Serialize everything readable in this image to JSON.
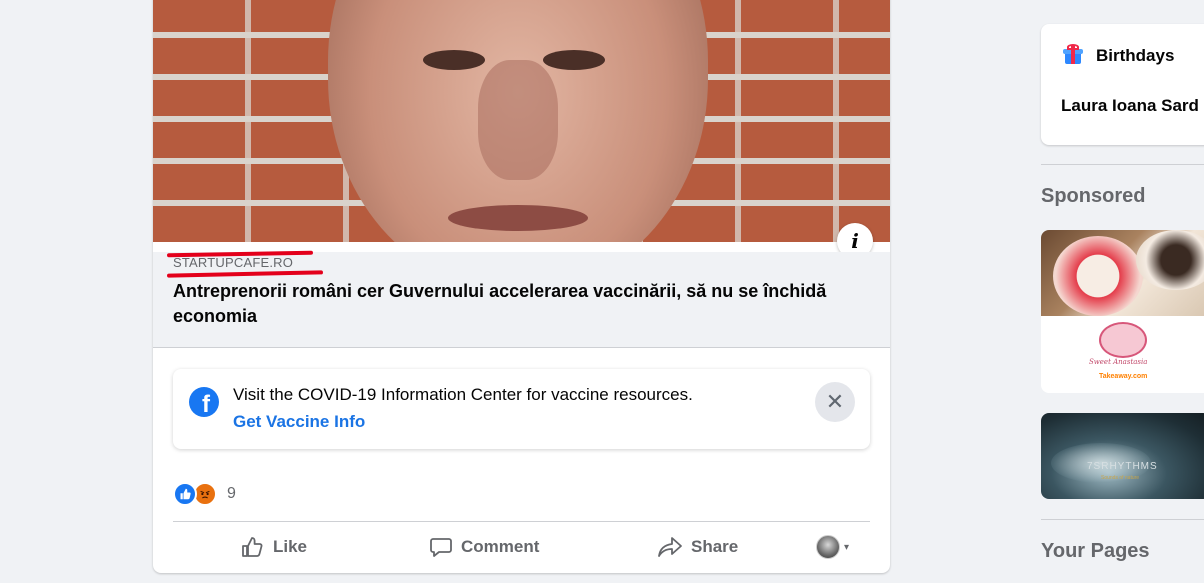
{
  "post": {
    "link_domain": "STARTUPCAFE.RO",
    "link_title": "Antreprenorii români cer Guvernului accelerarea vaccinării, să nu se închidă economia",
    "info_glyph": "i",
    "covid_banner": {
      "text": "Visit the COVID-19 Information Center for vaccine resources.",
      "link": "Get Vaccine Info",
      "close_glyph": "✕",
      "fb_glyph": "f"
    },
    "reactions": {
      "types": [
        "like-icon",
        "angry-icon"
      ],
      "count": "9"
    },
    "actions": {
      "like": "Like",
      "comment": "Comment",
      "share": "Share",
      "caret": "▾"
    }
  },
  "right_column": {
    "birthdays": {
      "title": "Birthdays",
      "name": "Laura Ioana Sard"
    },
    "sponsored_title": "Sponsored",
    "ads": [
      {
        "brand": "Sweet Anastasia",
        "network": "Takeaway.com"
      },
      {
        "brand": "7SRHYTHMS",
        "tagline": "Sounds of nature"
      }
    ],
    "your_pages_title": "Your Pages"
  },
  "colors": {
    "accent": "#1b74e4",
    "fb_blue": "#1877f2",
    "annotation_red": "#e3001b",
    "background": "#f0f2f5"
  }
}
